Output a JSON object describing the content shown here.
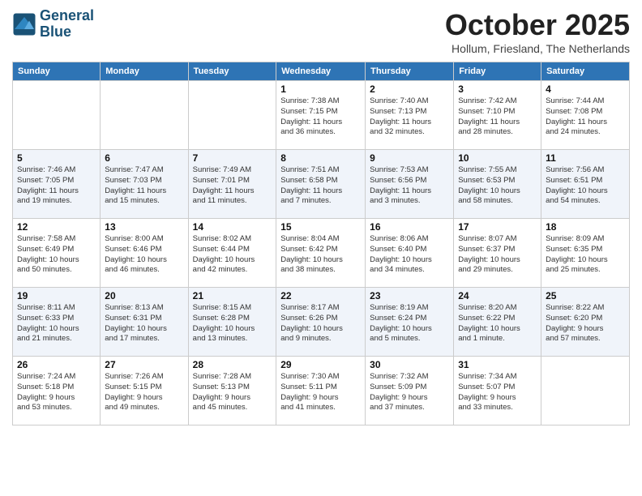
{
  "header": {
    "logo_line1": "General",
    "logo_line2": "Blue",
    "month": "October 2025",
    "location": "Hollum, Friesland, The Netherlands"
  },
  "days_of_week": [
    "Sunday",
    "Monday",
    "Tuesday",
    "Wednesday",
    "Thursday",
    "Friday",
    "Saturday"
  ],
  "weeks": [
    [
      {
        "day": "",
        "info": ""
      },
      {
        "day": "",
        "info": ""
      },
      {
        "day": "",
        "info": ""
      },
      {
        "day": "1",
        "info": "Sunrise: 7:38 AM\nSunset: 7:15 PM\nDaylight: 11 hours\nand 36 minutes."
      },
      {
        "day": "2",
        "info": "Sunrise: 7:40 AM\nSunset: 7:13 PM\nDaylight: 11 hours\nand 32 minutes."
      },
      {
        "day": "3",
        "info": "Sunrise: 7:42 AM\nSunset: 7:10 PM\nDaylight: 11 hours\nand 28 minutes."
      },
      {
        "day": "4",
        "info": "Sunrise: 7:44 AM\nSunset: 7:08 PM\nDaylight: 11 hours\nand 24 minutes."
      }
    ],
    [
      {
        "day": "5",
        "info": "Sunrise: 7:46 AM\nSunset: 7:05 PM\nDaylight: 11 hours\nand 19 minutes."
      },
      {
        "day": "6",
        "info": "Sunrise: 7:47 AM\nSunset: 7:03 PM\nDaylight: 11 hours\nand 15 minutes."
      },
      {
        "day": "7",
        "info": "Sunrise: 7:49 AM\nSunset: 7:01 PM\nDaylight: 11 hours\nand 11 minutes."
      },
      {
        "day": "8",
        "info": "Sunrise: 7:51 AM\nSunset: 6:58 PM\nDaylight: 11 hours\nand 7 minutes."
      },
      {
        "day": "9",
        "info": "Sunrise: 7:53 AM\nSunset: 6:56 PM\nDaylight: 11 hours\nand 3 minutes."
      },
      {
        "day": "10",
        "info": "Sunrise: 7:55 AM\nSunset: 6:53 PM\nDaylight: 10 hours\nand 58 minutes."
      },
      {
        "day": "11",
        "info": "Sunrise: 7:56 AM\nSunset: 6:51 PM\nDaylight: 10 hours\nand 54 minutes."
      }
    ],
    [
      {
        "day": "12",
        "info": "Sunrise: 7:58 AM\nSunset: 6:49 PM\nDaylight: 10 hours\nand 50 minutes."
      },
      {
        "day": "13",
        "info": "Sunrise: 8:00 AM\nSunset: 6:46 PM\nDaylight: 10 hours\nand 46 minutes."
      },
      {
        "day": "14",
        "info": "Sunrise: 8:02 AM\nSunset: 6:44 PM\nDaylight: 10 hours\nand 42 minutes."
      },
      {
        "day": "15",
        "info": "Sunrise: 8:04 AM\nSunset: 6:42 PM\nDaylight: 10 hours\nand 38 minutes."
      },
      {
        "day": "16",
        "info": "Sunrise: 8:06 AM\nSunset: 6:40 PM\nDaylight: 10 hours\nand 34 minutes."
      },
      {
        "day": "17",
        "info": "Sunrise: 8:07 AM\nSunset: 6:37 PM\nDaylight: 10 hours\nand 29 minutes."
      },
      {
        "day": "18",
        "info": "Sunrise: 8:09 AM\nSunset: 6:35 PM\nDaylight: 10 hours\nand 25 minutes."
      }
    ],
    [
      {
        "day": "19",
        "info": "Sunrise: 8:11 AM\nSunset: 6:33 PM\nDaylight: 10 hours\nand 21 minutes."
      },
      {
        "day": "20",
        "info": "Sunrise: 8:13 AM\nSunset: 6:31 PM\nDaylight: 10 hours\nand 17 minutes."
      },
      {
        "day": "21",
        "info": "Sunrise: 8:15 AM\nSunset: 6:28 PM\nDaylight: 10 hours\nand 13 minutes."
      },
      {
        "day": "22",
        "info": "Sunrise: 8:17 AM\nSunset: 6:26 PM\nDaylight: 10 hours\nand 9 minutes."
      },
      {
        "day": "23",
        "info": "Sunrise: 8:19 AM\nSunset: 6:24 PM\nDaylight: 10 hours\nand 5 minutes."
      },
      {
        "day": "24",
        "info": "Sunrise: 8:20 AM\nSunset: 6:22 PM\nDaylight: 10 hours\nand 1 minute."
      },
      {
        "day": "25",
        "info": "Sunrise: 8:22 AM\nSunset: 6:20 PM\nDaylight: 9 hours\nand 57 minutes."
      }
    ],
    [
      {
        "day": "26",
        "info": "Sunrise: 7:24 AM\nSunset: 5:18 PM\nDaylight: 9 hours\nand 53 minutes."
      },
      {
        "day": "27",
        "info": "Sunrise: 7:26 AM\nSunset: 5:15 PM\nDaylight: 9 hours\nand 49 minutes."
      },
      {
        "day": "28",
        "info": "Sunrise: 7:28 AM\nSunset: 5:13 PM\nDaylight: 9 hours\nand 45 minutes."
      },
      {
        "day": "29",
        "info": "Sunrise: 7:30 AM\nSunset: 5:11 PM\nDaylight: 9 hours\nand 41 minutes."
      },
      {
        "day": "30",
        "info": "Sunrise: 7:32 AM\nSunset: 5:09 PM\nDaylight: 9 hours\nand 37 minutes."
      },
      {
        "day": "31",
        "info": "Sunrise: 7:34 AM\nSunset: 5:07 PM\nDaylight: 9 hours\nand 33 minutes."
      },
      {
        "day": "",
        "info": ""
      }
    ]
  ]
}
